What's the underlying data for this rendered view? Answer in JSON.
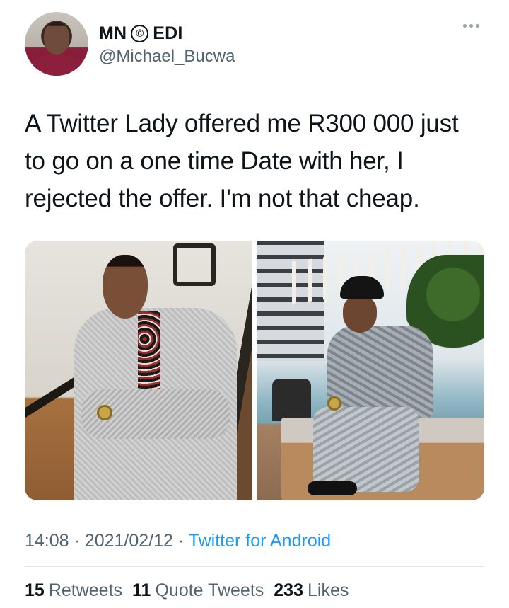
{
  "author": {
    "name_part1": "MN",
    "name_part2": "EDI",
    "name_symbol": "©",
    "handle": "@Michael_Bucwa"
  },
  "tweet": {
    "text": "A Twitter Lady offered me R300 000 just to go on a one time Date with her, I rejected the offer. I'm not that cheap."
  },
  "meta": {
    "time": "14:08",
    "separator": "·",
    "date": "2021/02/12",
    "source": "Twitter for Android"
  },
  "stats": {
    "retweets_count": "15",
    "retweets_label": "Retweets",
    "quote_count": "11",
    "quote_label": "Quote Tweets",
    "likes_count": "233",
    "likes_label": "Likes"
  },
  "icons": {
    "more": "more-horizontal-icon"
  },
  "colors": {
    "text": "#0f1419",
    "secondary": "#536471",
    "link": "#1d9bf0",
    "divider": "#e1e5e8"
  }
}
